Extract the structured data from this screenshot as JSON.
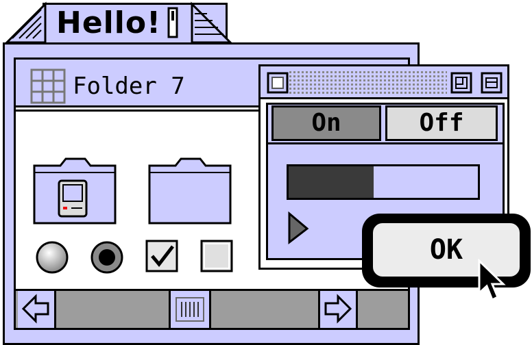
{
  "main_window": {
    "title": "Hello!"
  },
  "folder_window": {
    "title": "Folder 7"
  },
  "toggle": {
    "on_label": "On",
    "off_label": "Off",
    "selected": "On"
  },
  "progress": {
    "fraction": 0.45
  },
  "dialog": {
    "ok_label": "OK"
  },
  "controls": {
    "radio_1_selected": false,
    "radio_2_selected": true,
    "checkbox_1_checked": true,
    "checkbox_2_checked": false
  },
  "icons": [
    "grid-view-icon",
    "folder-icon",
    "computer-icon",
    "left-arrow-icon",
    "right-arrow-icon",
    "disclosure-triangle-icon",
    "pointer-cursor-icon"
  ],
  "colors": {
    "window": "#ccccff",
    "frame": "#000000",
    "scroll_track": "#9d9d9d"
  }
}
